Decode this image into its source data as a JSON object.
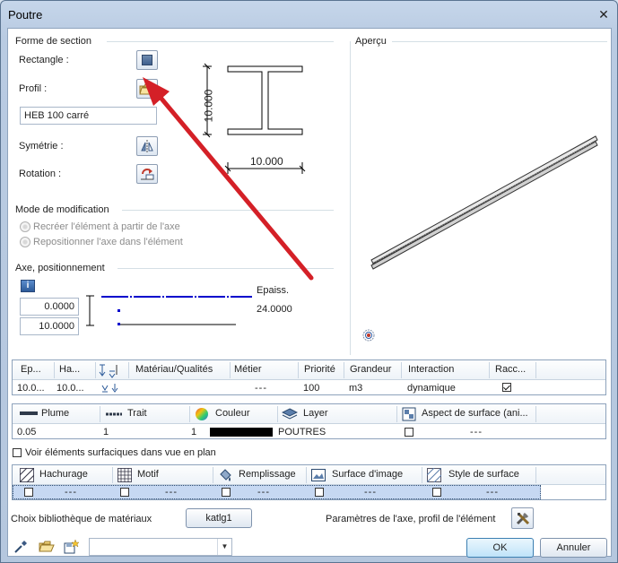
{
  "window": {
    "title": "Poutre"
  },
  "section": {
    "group_title": "Forme de section",
    "rectangle_label": "Rectangle :",
    "profile_label": "Profil :",
    "profile_value": "HEB 100 carré",
    "symmetry_label": "Symétrie :",
    "rotation_label": "Rotation :",
    "dim_height": "10.000",
    "dim_width": "10.000"
  },
  "preview": {
    "group_title": "Aperçu"
  },
  "mode": {
    "group_title": "Mode de modification",
    "options": [
      "Recréer l'élément à partir de l'axe",
      "Repositionner l'axe dans l'élément"
    ]
  },
  "axis": {
    "group_title": "Axe, positionnement",
    "value_top": "0.0000",
    "value_bottom": "10.0000",
    "thickness_label": "Epaiss.",
    "thickness_value": "24.0000"
  },
  "table1": {
    "headers": [
      "Ep...",
      "Ha...",
      "",
      "Matériau/Qualités",
      "Métier",
      "Priorité",
      "Grandeur",
      "Interaction",
      "Racc..."
    ],
    "row": [
      "10.0...",
      "10.0...",
      "",
      "",
      "---",
      "100",
      "m3",
      "dynamique",
      ""
    ]
  },
  "table2": {
    "headers": [
      "Plume",
      "Trait",
      "Couleur",
      "Layer",
      "Aspect de surface (ani..."
    ],
    "row": [
      "0.05",
      "1",
      "1",
      "",
      "POUTRES",
      "---"
    ],
    "colors": {
      "couleur_swatch": "#000000"
    }
  },
  "surface_checkbox": "Voir éléments surfaciques dans vue en plan",
  "table3": {
    "headers": [
      "Hachurage",
      "Motif",
      "Remplissage",
      "Surface d'image",
      "Style de surface"
    ],
    "dashes": [
      "---",
      "---",
      "---",
      "---",
      "---"
    ]
  },
  "bottom": {
    "library_label": "Choix bibliothèque de matériaux",
    "library_button": "katlg1",
    "axis_params_label": "Paramètres de l'axe, profil de l'élément",
    "ok": "OK",
    "cancel": "Annuler"
  },
  "colors": {
    "arrow": "#d42027",
    "accent_line": "#0000cc",
    "titlebar": "#c6d6ea"
  }
}
